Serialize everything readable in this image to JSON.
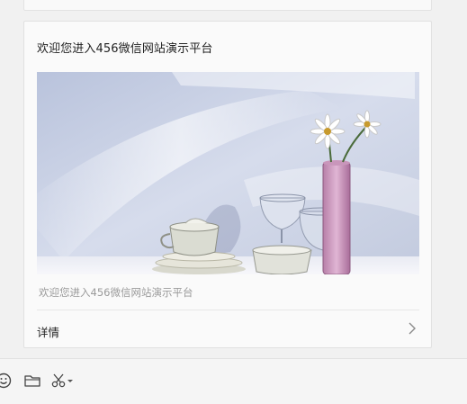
{
  "article": {
    "title": "欢迎您进入456微信网站演示平台",
    "digest": "欢迎您进入456微信网站演示平台",
    "detail_label": "详情",
    "cover_description": "still life cover image"
  },
  "toolbar": {
    "icons": [
      "emoji-icon",
      "folder-icon",
      "scissors-icon",
      "dropdown-arrow-icon"
    ]
  },
  "colors": {
    "page_bg": "#f1f1f1",
    "card_bg": "#fafafa",
    "border": "#e1e1e1",
    "title_text": "#222222",
    "digest_text": "#9a9a9a"
  }
}
